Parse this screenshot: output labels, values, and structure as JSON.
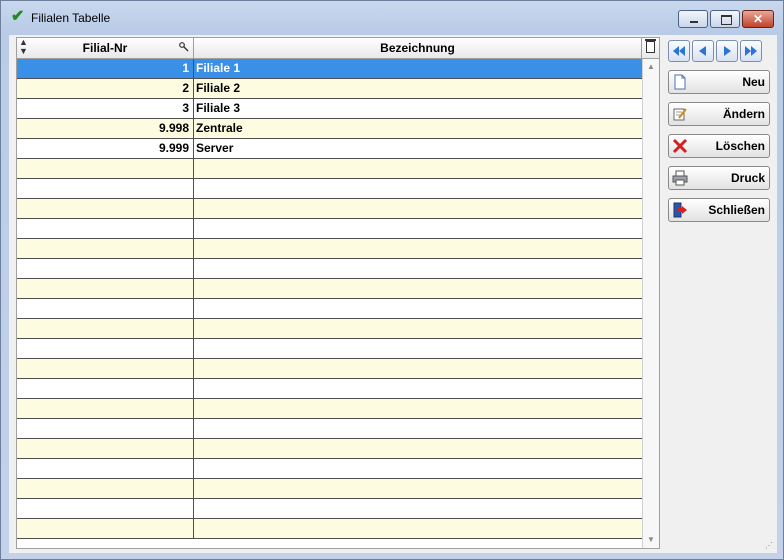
{
  "window": {
    "title": "Filialen Tabelle"
  },
  "table": {
    "columns": [
      "Filial-Nr",
      "Bezeichnung"
    ],
    "rows": [
      {
        "nr": "1",
        "name": "Filiale 1",
        "selected": true
      },
      {
        "nr": "2",
        "name": "Filiale 2"
      },
      {
        "nr": "3",
        "name": "Filiale 3"
      },
      {
        "nr": "9.998",
        "name": "Zentrale"
      },
      {
        "nr": "9.999",
        "name": "Server"
      }
    ],
    "empty_rows": 19
  },
  "navigation": {
    "icons": [
      "first-record-icon",
      "previous-record-icon",
      "next-record-icon",
      "last-record-icon"
    ]
  },
  "actions": {
    "neu": "Neu",
    "aendern": "Ändern",
    "loeschen": "Löschen",
    "druck": "Druck",
    "schliessen": "Schließen"
  },
  "colors": {
    "selected_row": "#3a90e6",
    "alt_row": "#fdfbe0",
    "accent_nav": "#2a74d8",
    "delete_red": "#d42020"
  }
}
